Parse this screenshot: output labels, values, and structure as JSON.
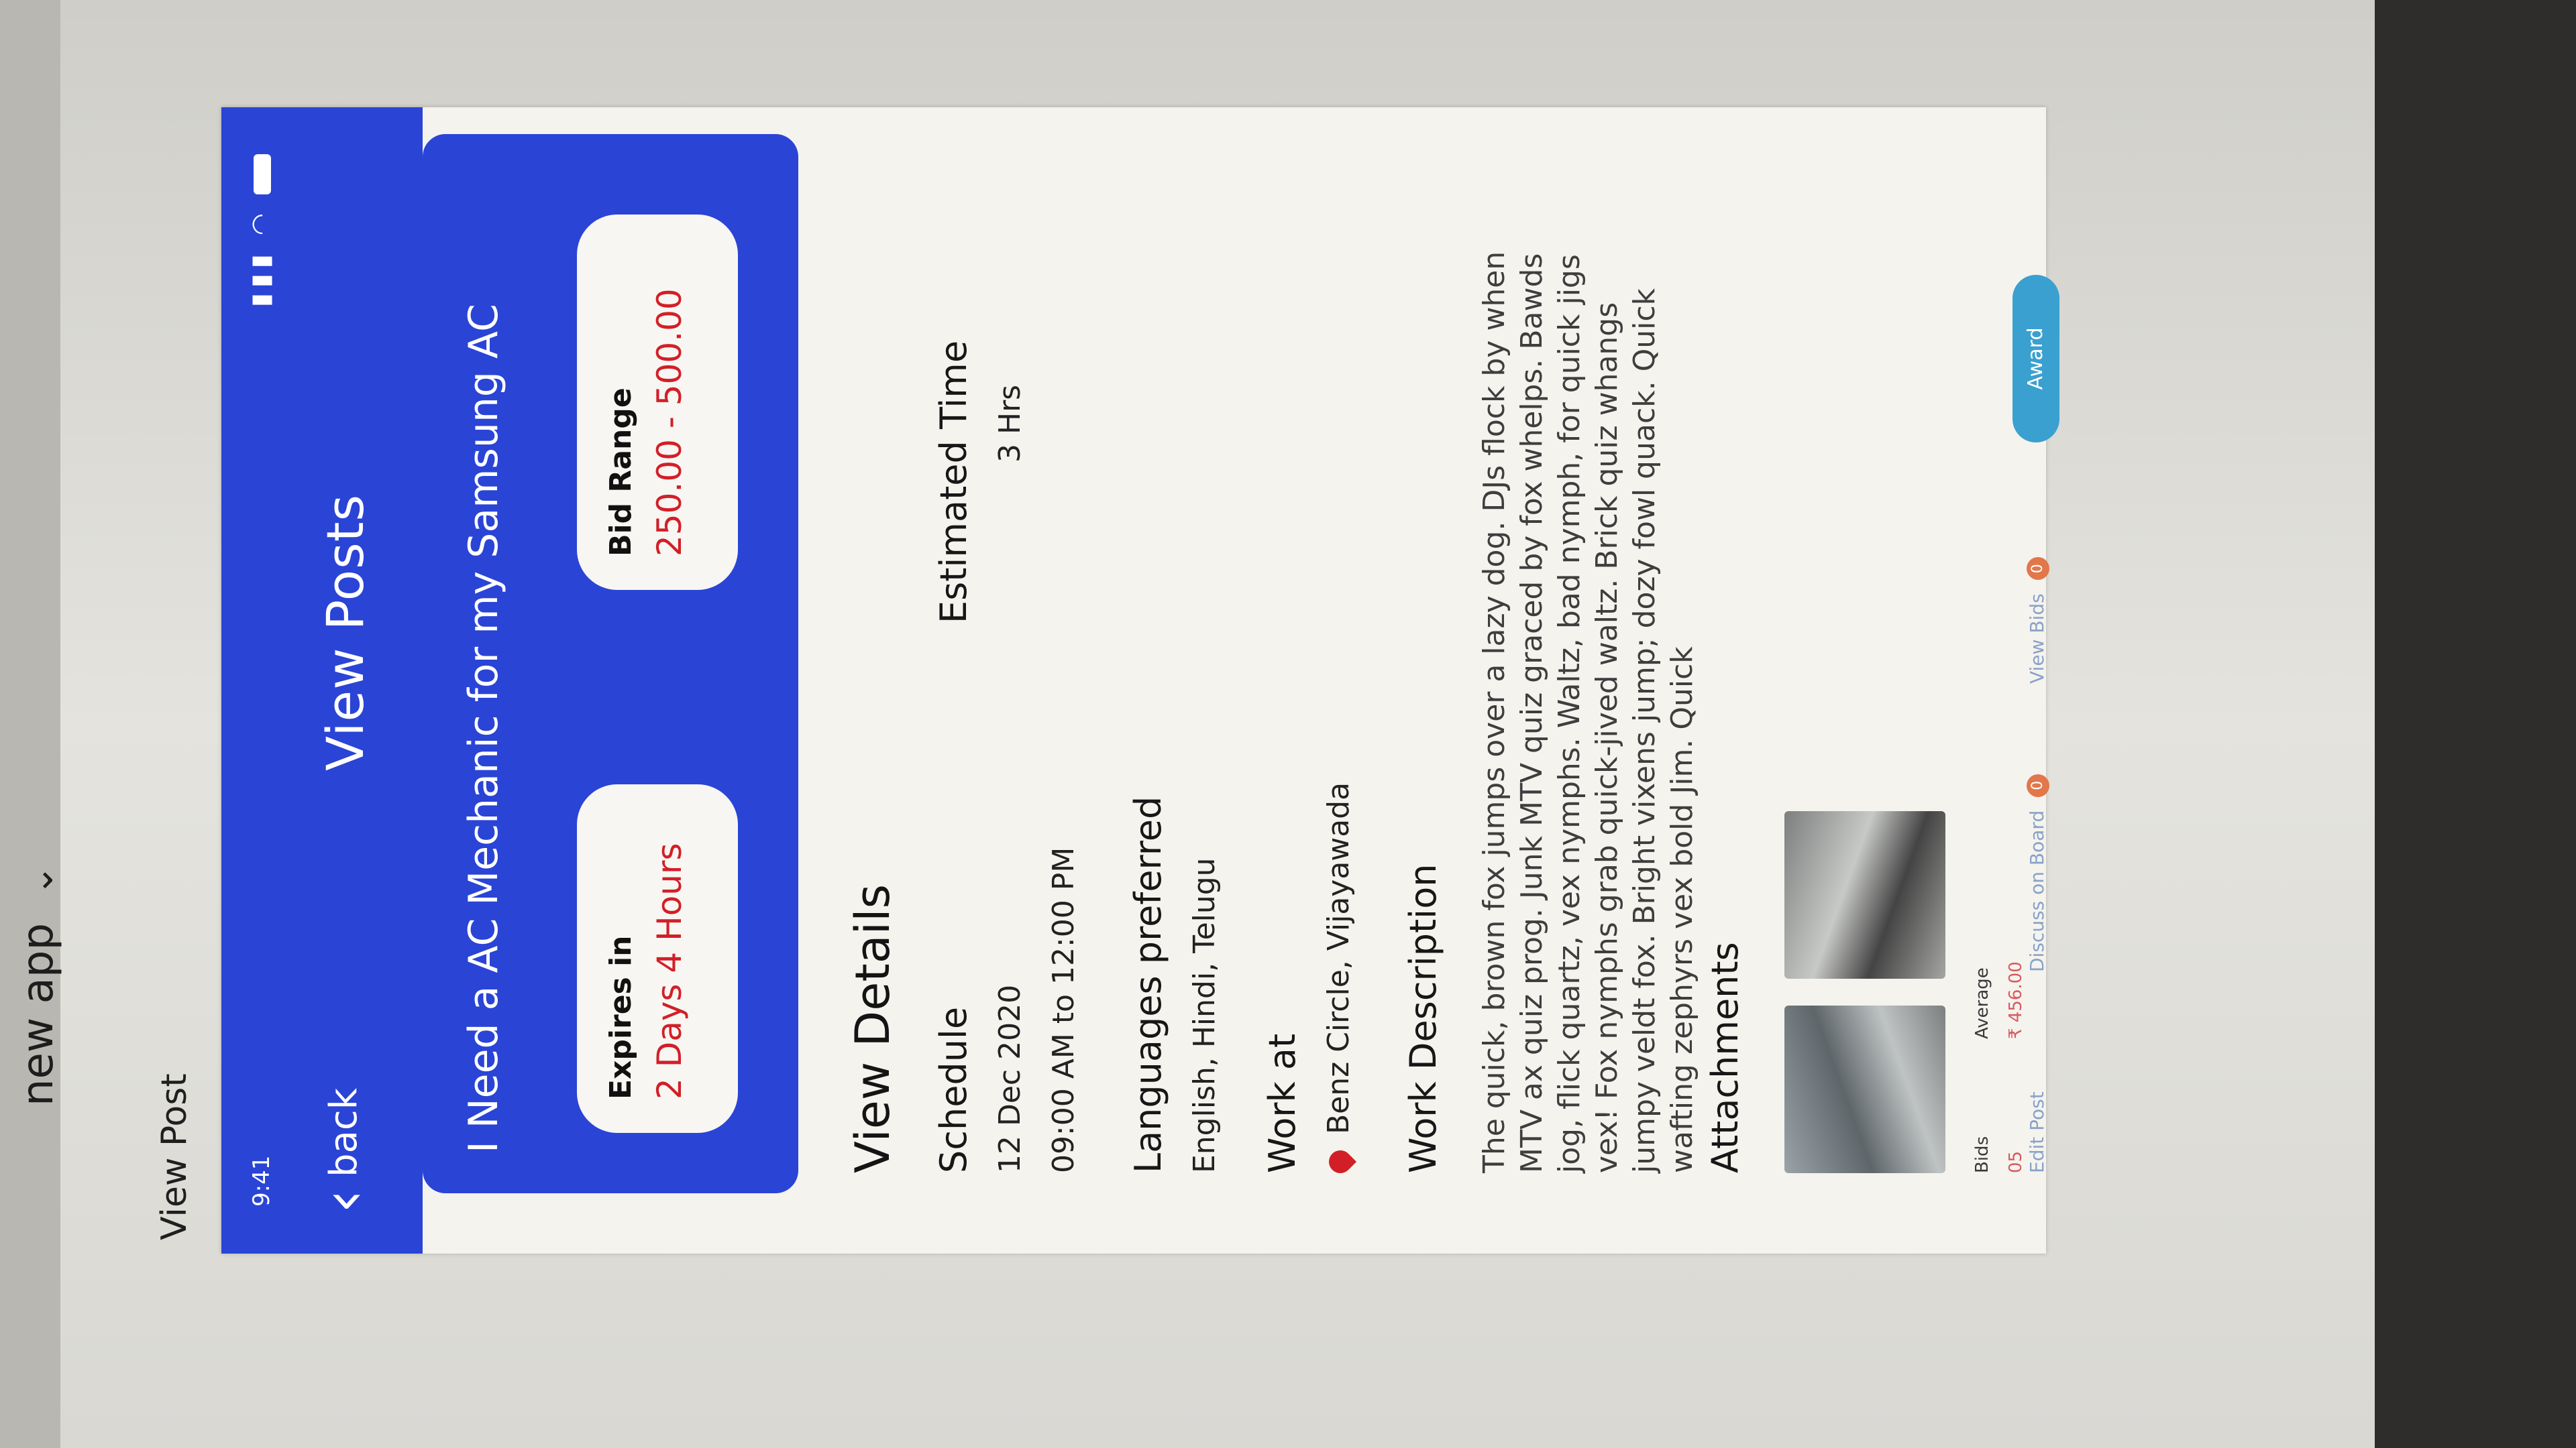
{
  "app_switcher": {
    "label": "new app"
  },
  "window": {
    "title": "View Post"
  },
  "status_bar": {
    "time": "9:41"
  },
  "topbar": {
    "back_label": "back",
    "title": "View Posts"
  },
  "job": {
    "title": "I Need a AC Mechanic for my Samsung AC",
    "expires_label": "Expires in",
    "expires_value": "2 Days 4 Hours",
    "bid_label": "Bid Range",
    "bid_value": "250.00 - 500.00"
  },
  "details": {
    "heading": "View Details",
    "schedule_label": "Schedule",
    "schedule_date": "12 Dec 2020",
    "schedule_time": "09:00 AM to 12:00 PM",
    "estimated_label": "Estimated Time",
    "estimated_value": "3 Hrs",
    "languages_label": "Languages preferred",
    "languages_value": "English, Hindi, Telugu",
    "work_at_label": "Work at",
    "work_at_value": "Benz Circle, Vijayawada",
    "description_label": "Work Description",
    "description_text": "The quick, brown fox jumps over a lazy dog. DJs flock by when MTV ax quiz prog. Junk MTV quiz graced by fox whelps. Bawds jog, flick quartz, vex nymphs. Waltz, bad nymph, for quick jigs vex! Fox nymphs grab quick-jived waltz. Brick quiz whangs jumpy veldt fox. Bright vixens jump; dozy fowl quack. Quick wafting zephyrs vex bold Jim. Quick",
    "attachments_label": "Attachments"
  },
  "footer": {
    "bids_label": "Bids",
    "bids_value": "05",
    "average_label": "Average",
    "average_value": "₹ 456.00",
    "edit_label": "Edit Post",
    "discuss_label": "Discuss on Board",
    "discuss_count": "0",
    "view_bids_label": "View Bids",
    "view_bids_count": "0",
    "award_label": "Award"
  },
  "colors": {
    "primary": "#2a44d6",
    "accent_red": "#d21f27",
    "award": "#3aa0d0"
  }
}
